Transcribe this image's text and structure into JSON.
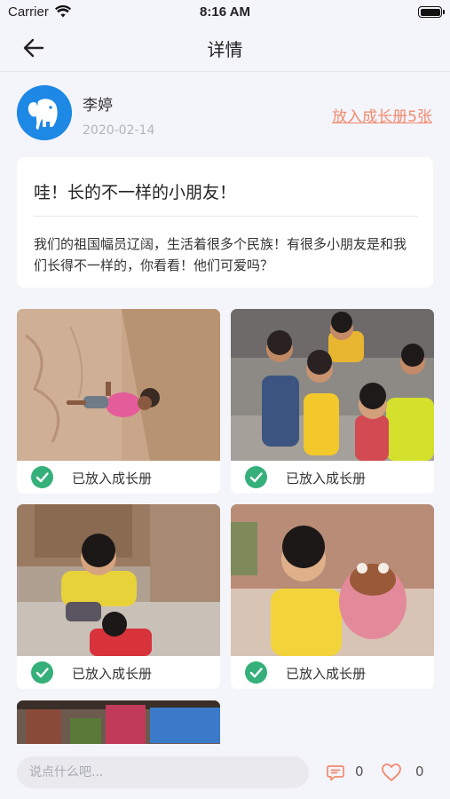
{
  "status": {
    "carrier": "Carrier",
    "time": "8:16 AM"
  },
  "nav": {
    "title": "详情"
  },
  "author": {
    "name": "李婷",
    "date": "2020-02-14"
  },
  "actions": {
    "add_growth_link": "放入成长册5张"
  },
  "post": {
    "title": "哇！长的不一样的小朋友！",
    "body": "我们的祖国幅员辽阔，生活着很多个民族！有很多小朋友是和我们长得不一样的，你看看！他们可爱吗？"
  },
  "photos": [
    {
      "status_label": "已放入成长册"
    },
    {
      "status_label": "已放入成长册"
    },
    {
      "status_label": "已放入成长册"
    },
    {
      "status_label": "已放入成长册"
    }
  ],
  "comment": {
    "placeholder": "说点什么吧...",
    "comment_count": "0",
    "like_count": "0"
  },
  "colors": {
    "accent_link": "#f08a6c",
    "check_green": "#36b07a",
    "avatar_blue": "#1e88e5"
  },
  "icons": [
    "wifi-icon",
    "battery-icon",
    "back-arrow-icon",
    "elephant-icon",
    "check-icon",
    "comment-icon",
    "heart-icon"
  ]
}
